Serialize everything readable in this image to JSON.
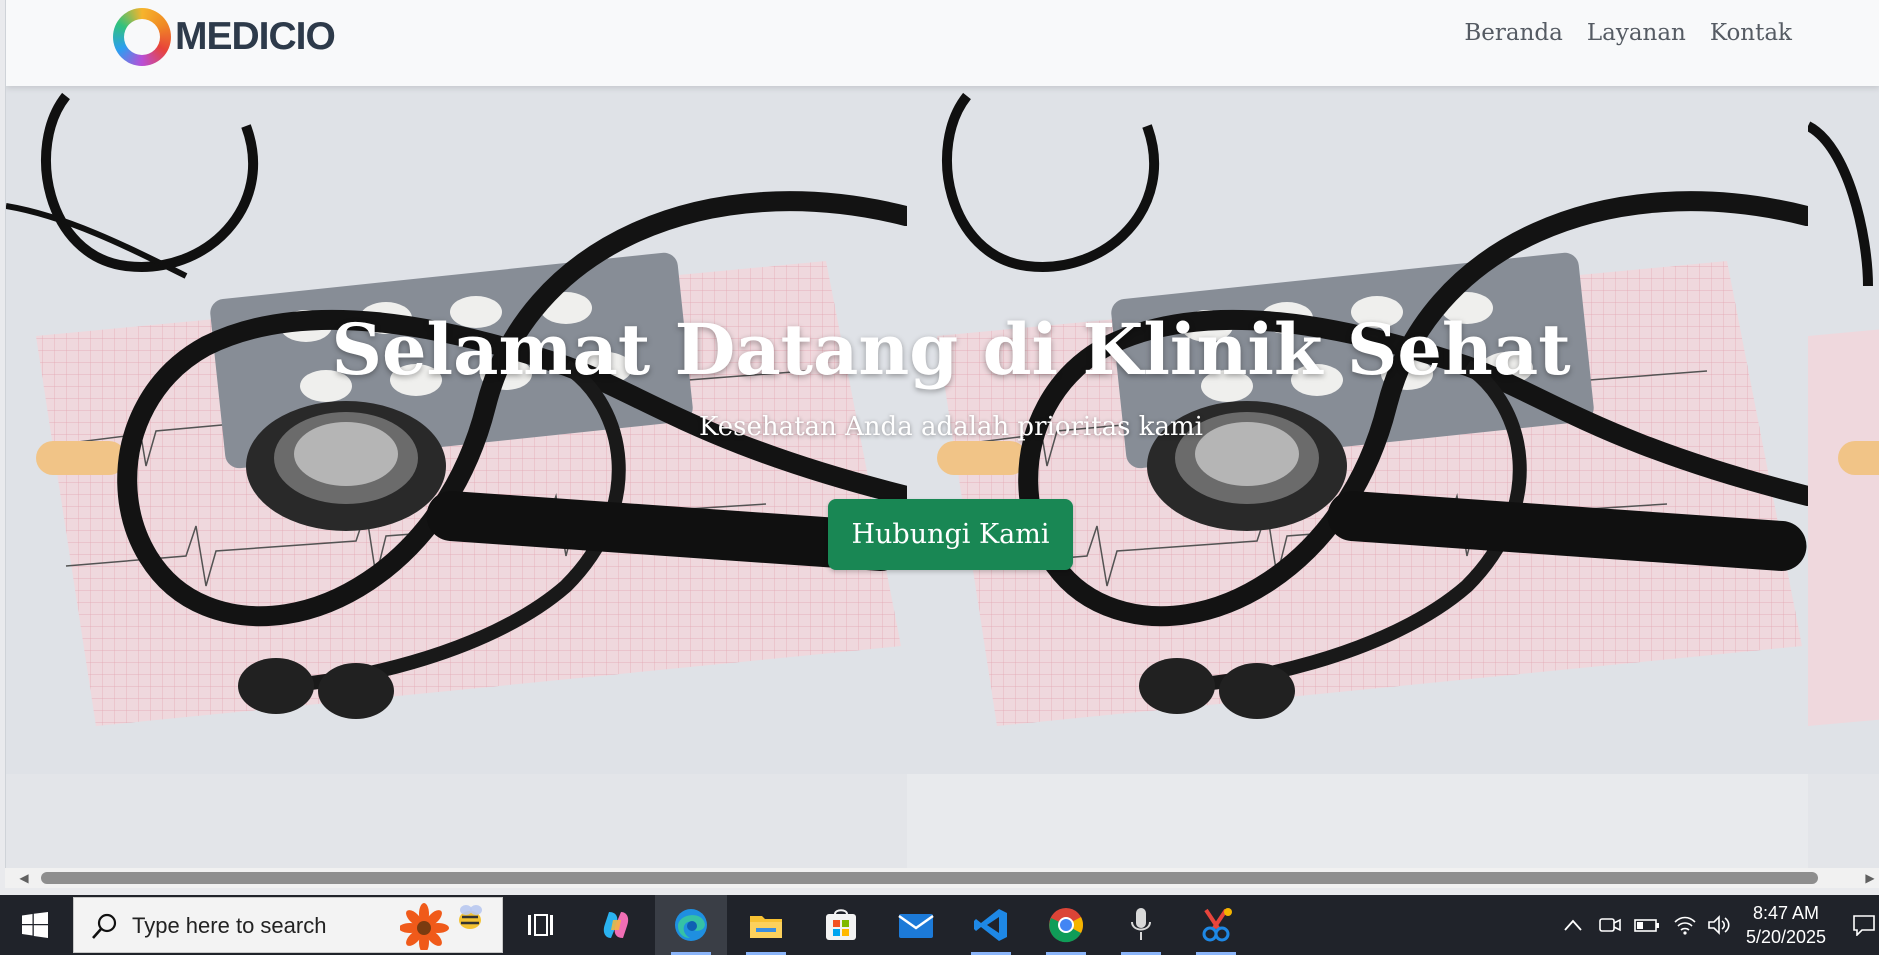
{
  "brand": {
    "name": "MEDICIO"
  },
  "nav": {
    "items": [
      {
        "label": "Beranda"
      },
      {
        "label": "Layanan"
      },
      {
        "label": "Kontak"
      }
    ]
  },
  "hero": {
    "title": "Selamat Datang di Klinik Sehat",
    "subtitle": "Kesehatan Anda adalah prioritas kami",
    "cta_label": "Hubungi Kami",
    "background_image": "stethoscope-ecg-pills-photo"
  },
  "colors": {
    "cta": "#198754",
    "nav_bg": "#f8f9fa",
    "nav_text": "#555b63",
    "taskbar": "#20232a"
  },
  "taskbar": {
    "search_placeholder": "Type here to search",
    "apps": [
      "task-view",
      "copilot",
      "edge",
      "file-explorer",
      "microsoft-store",
      "mail",
      "vscode",
      "chrome",
      "voice-recorder",
      "snipping-tool"
    ],
    "time": "8:47 AM",
    "date": "5/20/2025"
  }
}
